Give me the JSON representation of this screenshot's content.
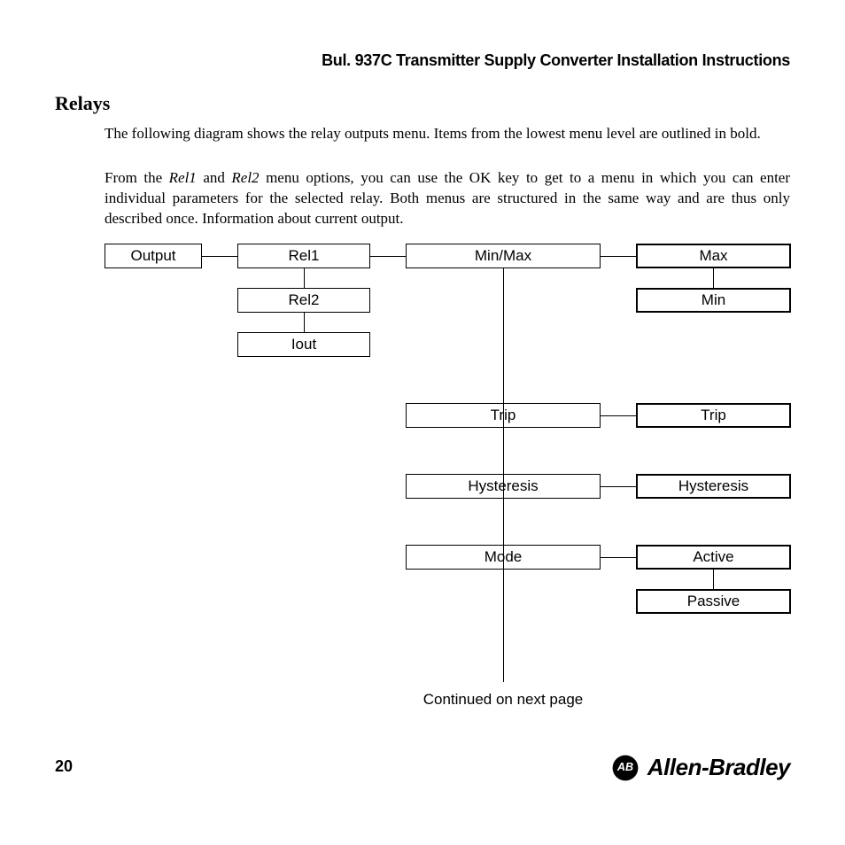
{
  "header": {
    "title": "Bul. 937C Transmitter Supply Converter Installation Instructions"
  },
  "section": {
    "title": "Relays"
  },
  "paragraphs": {
    "p1": "The following diagram shows the relay outputs menu. Items from the lowest menu level are outlined in bold.",
    "p2a": "From the ",
    "p2_rel1": "Rel1",
    "p2b": " and ",
    "p2_rel2": "Rel2",
    "p2c": " menu options, you can use the OK key to get to a menu in which you can enter individual parameters for the selected relay. Both menus are structured in the same way and are thus only described once. Information about current output."
  },
  "diagram": {
    "col1": {
      "output": "Output"
    },
    "col2": {
      "rel1": "Rel1",
      "rel2": "Rel2",
      "iout": "Iout"
    },
    "col3": {
      "minmax": "Min/Max",
      "trip": "Trip",
      "hysteresis": "Hysteresis",
      "mode": "Mode"
    },
    "col4": {
      "max": "Max",
      "min": "Min",
      "trip": "Trip",
      "hysteresis": "Hysteresis",
      "active": "Active",
      "passive": "Passive"
    },
    "continued": "Continued on next page"
  },
  "footer": {
    "page": "20",
    "brand": "Allen-Bradley"
  }
}
